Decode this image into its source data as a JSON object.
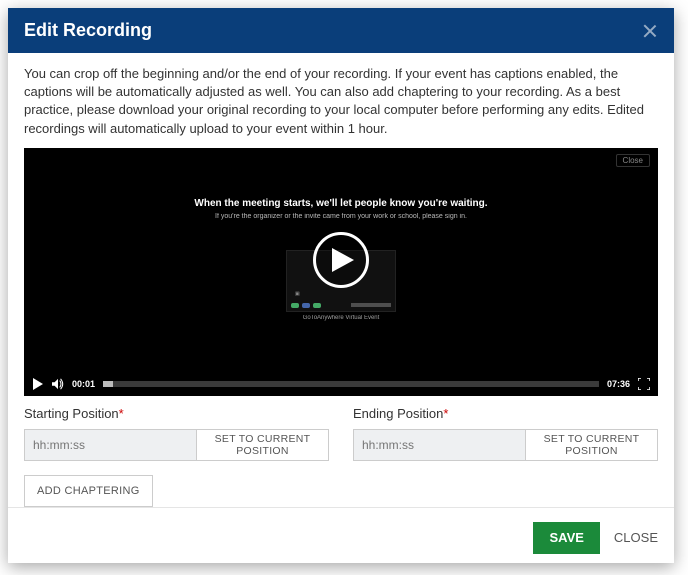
{
  "header": {
    "title": "Edit Recording"
  },
  "description": "You can crop off the beginning and/or the end of your recording. If your event has captions enabled, the captions will be automatically adjusted as well. You can also add chaptering to your recording. As a best practice, please download your original recording to your local computer before performing any edits. Edited recordings will automatically upload to your event within 1 hour.",
  "video": {
    "waiting_title": "When the meeting starts, we'll let people know you're waiting.",
    "waiting_sub": "If you're the organizer or the invite came from your work or school, please sign in.",
    "thumb_caption": "GoToAnywhere Virtual Event",
    "close_badge": "Close",
    "current_time": "00:01",
    "duration": "07:36"
  },
  "form": {
    "start": {
      "label": "Starting Position",
      "required_marker": "*",
      "placeholder": "hh:mm:ss",
      "set_btn": "SET TO CURRENT POSITION"
    },
    "end": {
      "label": "Ending Position",
      "required_marker": "*",
      "placeholder": "hh:mm:ss",
      "set_btn": "SET TO CURRENT POSITION"
    },
    "add_chaptering": "ADD CHAPTERING"
  },
  "footer": {
    "save": "SAVE",
    "close": "CLOSE"
  }
}
